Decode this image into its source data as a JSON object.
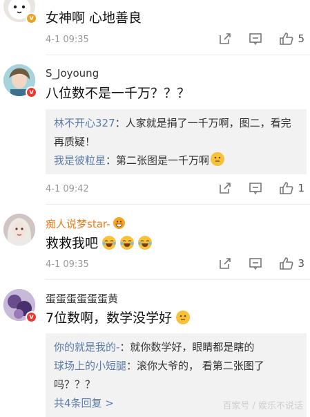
{
  "comments": [
    {
      "username": "",
      "content": "女神啊  心地善良",
      "time": "4-1 09:35",
      "likes": "5"
    },
    {
      "username": "S_Joyoung",
      "content": "八位数不是一千万？？？",
      "replies": [
        {
          "name": "林不开心327",
          "text": "：人家就是捐了一千万啊，图二，看完再质疑！"
        },
        {
          "name": "我是彼粒星",
          "text": "：第二张图是一千万啊"
        }
      ],
      "time": "4-1 09:42",
      "likes": "1"
    },
    {
      "username": "痴人说梦star-",
      "content": "救救我吧",
      "time": "4-1 09:35",
      "likes": "3"
    },
    {
      "username": "蛋蛋蛋蛋蛋蛋黄",
      "content": "7位数啊，数学没学好",
      "replies": [
        {
          "name": "你的就是我的-",
          "text": "：就你数学好，眼睛都是瞎的"
        },
        {
          "name": "球场上的小短腿",
          "text": "：滚你大爷的， 看第二张图了吗？？？"
        }
      ],
      "more": "共4条回复 >"
    }
  ],
  "colors": {
    "link": "#5a7ba8",
    "orange_name": "#f07a1a",
    "meta": "#999999",
    "reply_bg": "#f2f2f2"
  },
  "icons": [
    "share-icon",
    "comment-icon",
    "like-icon",
    "grinning-emoji",
    "crying-laughing-emoji",
    "thinking-emoji",
    "v-badge-icon"
  ],
  "watermark": "百家号 / 娱乐不说话"
}
